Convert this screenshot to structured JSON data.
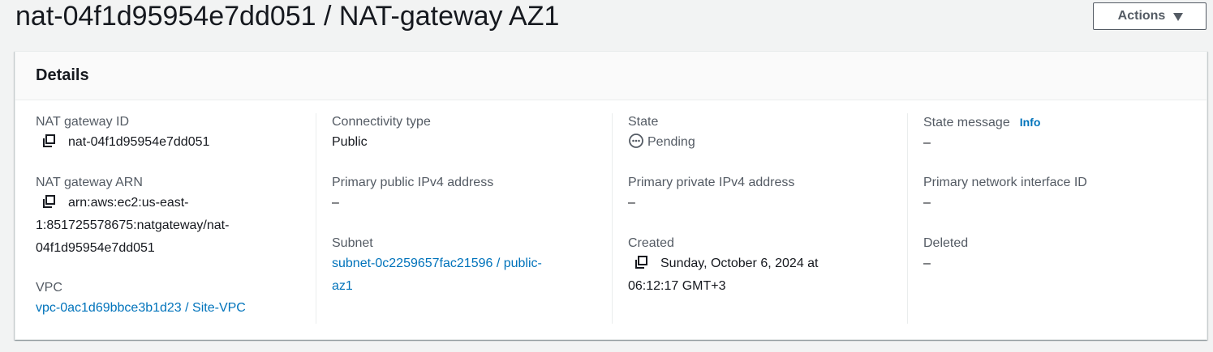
{
  "header": {
    "title": "nat-04f1d95954e7dd051 / NAT-gateway AZ1",
    "actions_label": "Actions"
  },
  "details": {
    "title": "Details",
    "nat_gateway_id": {
      "label": "NAT gateway ID",
      "value": "nat-04f1d95954e7dd051"
    },
    "nat_gateway_arn": {
      "label": "NAT gateway ARN",
      "value_line1": "arn:aws:ec2:us-east-",
      "value_line2": "1:851725578675:natgateway/nat-",
      "value_line3": "04f1d95954e7dd051"
    },
    "vpc": {
      "label": "VPC",
      "value": "vpc-0ac1d69bbce3b1d23 / Site-VPC"
    },
    "connectivity_type": {
      "label": "Connectivity type",
      "value": "Public"
    },
    "primary_public_ipv4": {
      "label": "Primary public IPv4 address",
      "value": "–"
    },
    "subnet": {
      "label": "Subnet",
      "value_line1": "subnet-0c2259657fac21596 / public-",
      "value_line2": "az1"
    },
    "state": {
      "label": "State",
      "value": "Pending"
    },
    "primary_private_ipv4": {
      "label": "Primary private IPv4 address",
      "value": "–"
    },
    "created": {
      "label": "Created",
      "value_line1": "Sunday, October 6, 2024 at",
      "value_line2": "06:12:17 GMT+3"
    },
    "state_message": {
      "label": "State message",
      "info_label": "Info",
      "value": "–"
    },
    "primary_network_interface": {
      "label": "Primary network interface ID",
      "value": "–"
    },
    "deleted": {
      "label": "Deleted",
      "value": "–"
    }
  },
  "colors": {
    "link": "#0073bb",
    "label": "#545b64",
    "text": "#16191f",
    "background": "#f2f3f3"
  },
  "icons": {
    "copy": "copy-icon",
    "pending": "pending-status-icon",
    "dropdown": "caret-down-icon"
  }
}
